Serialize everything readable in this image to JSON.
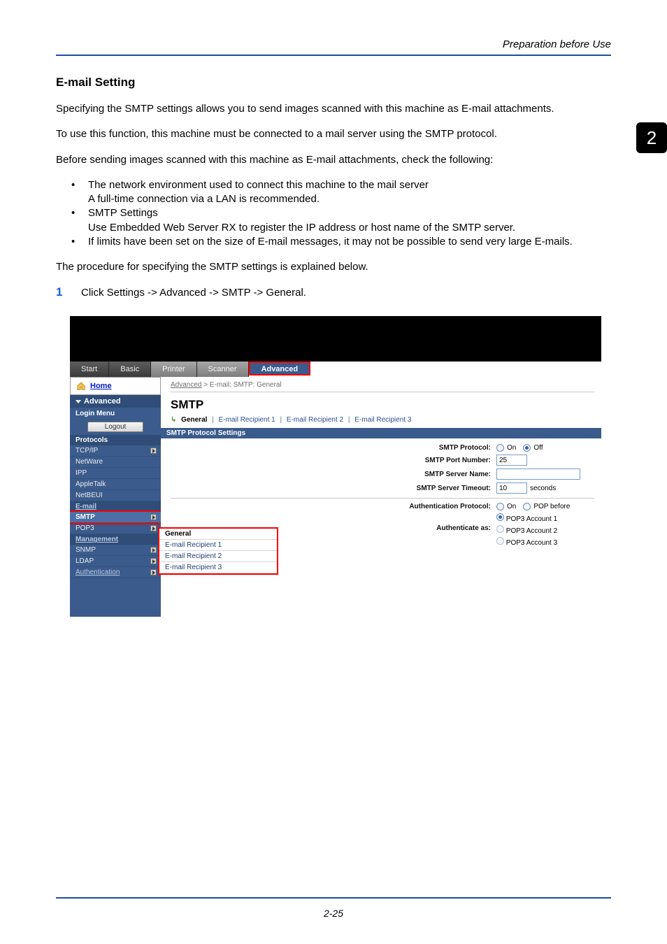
{
  "running_head": "Preparation before Use",
  "chapter_tab": "2",
  "section_title": "E-mail Setting",
  "para1": "Specifying the SMTP settings allows you to send images scanned with this machine as E-mail attachments.",
  "para2": "To use this function, this machine must be connected to a mail server using the SMTP protocol.",
  "para3": "Before sending images scanned with this machine as E-mail attachments, check the following:",
  "bullets": {
    "b1a": "The network environment used to connect this machine to the mail server",
    "b1b": "A full-time connection via a LAN is recommended.",
    "b2a": "SMTP Settings",
    "b2b": "Use Embedded Web Server RX to register the IP address or host name of the SMTP server.",
    "b3": "If limits have been set on the size of E-mail messages, it may not be possible to send very large E-mails."
  },
  "para4": "The procedure for specifying the SMTP settings is explained below.",
  "step1_num": "1",
  "step1_text": "Click Settings -> Advanced -> SMTP -> General.",
  "figure": {
    "tabs": {
      "start": "Start",
      "basic": "Basic",
      "printer": "Printer",
      "scanner": "Scanner",
      "advanced": "Advanced"
    },
    "sidebar": {
      "home": "Home",
      "advanced": "Advanced",
      "login_menu": "Login Menu",
      "logout_btn": "Logout",
      "protocols_head": "Protocols",
      "items_protocols": {
        "tcpip": "TCP/IP",
        "netware": "NetWare",
        "ipp": "IPP",
        "appletalk": "AppleTalk",
        "netbeui": "NetBEUI"
      },
      "email_head": "E-mail",
      "items_email": {
        "smtp": "SMTP",
        "pop3": "POP3"
      },
      "management_head": "Management",
      "items_mgmt": {
        "snmp": "SNMP",
        "ldap": "LDAP",
        "authentication": "Authentication"
      }
    },
    "main": {
      "crumb_advanced": "Advanced",
      "crumb_sep": "  >  ",
      "crumb_tail": "E-mail: SMTP: General",
      "smtp_title": "SMTP",
      "subnav": {
        "general": "General",
        "r1": "E-mail Recipient 1",
        "r2": "E-mail Recipient 2",
        "r3": "E-mail Recipient 3"
      },
      "band": "SMTP Protocol Settings",
      "rows": {
        "protocol_label": "SMTP Protocol:",
        "on": "On",
        "off": "Off",
        "port_label": "SMTP Port Number:",
        "port_value": "25",
        "server_label": "SMTP Server Name:",
        "server_value": "",
        "timeout_label": "SMTP Server Timeout:",
        "timeout_value": "10",
        "timeout_unit": "seconds",
        "authproto_label": "Authentication Protocol:",
        "popbefore": "POP before",
        "authas_label": "Authenticate as:",
        "acct1": "POP3 Account 1",
        "acct2": "POP3 Account 2",
        "acct3": "POP3 Account 3"
      }
    },
    "flyout": {
      "general": "General",
      "r1": "E-mail Recipient 1",
      "r2": "E-mail Recipient 2",
      "r3": "E-mail Recipient 3"
    }
  },
  "page_number": "2-25"
}
